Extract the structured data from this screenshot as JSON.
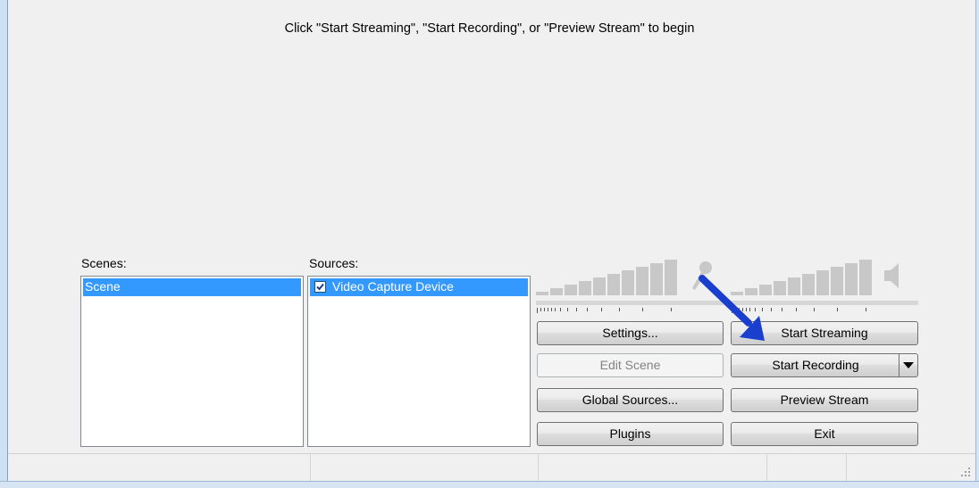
{
  "preview": {
    "message": "Click \"Start Streaming\", \"Start Recording\", or \"Preview Stream\" to begin"
  },
  "scenes": {
    "label": "Scenes:",
    "items": [
      "Scene"
    ]
  },
  "sources": {
    "label": "Sources:",
    "items": [
      {
        "label": "Video Capture Device",
        "checked": true
      }
    ]
  },
  "buttons": {
    "settings": "Settings...",
    "edit_scene": "Edit Scene",
    "global_sources": "Global Sources...",
    "plugins": "Plugins",
    "start_streaming": "Start Streaming",
    "start_recording": "Start Recording",
    "preview_stream": "Preview Stream",
    "exit": "Exit"
  },
  "icons": {
    "microphone": "microphone-icon",
    "speaker": "speaker-icon",
    "annotation_arrow": "arrow-icon"
  },
  "colors": {
    "selection": "#3399ff",
    "arrow": "#1a3fcf",
    "meter": "#c8c8c8"
  }
}
